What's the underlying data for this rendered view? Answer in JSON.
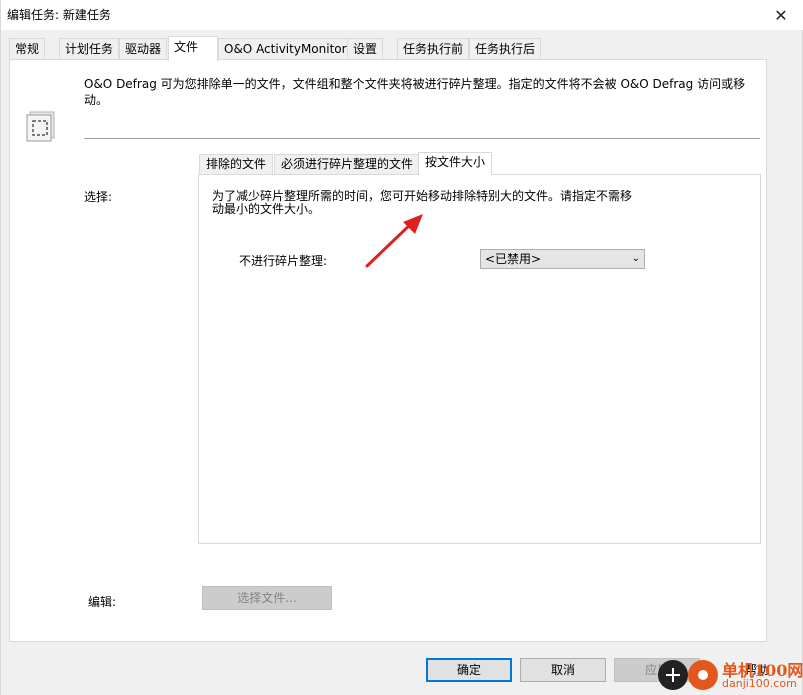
{
  "window": {
    "title": "编辑任务: 新建任务"
  },
  "tabs": [
    {
      "label": "常规"
    },
    {
      "label": "计划任务"
    },
    {
      "label": "驱动器"
    },
    {
      "label": "文件"
    },
    {
      "label": "O&O ActivityMonitor"
    },
    {
      "label": "设置"
    },
    {
      "label": "任务执行前"
    },
    {
      "label": "任务执行后"
    }
  ],
  "active_tab": "文件",
  "files": {
    "description": "O&O Defrag 可为您排除单一的文件，文件组和整个文件夹将被进行碎片整理。指定的文件将不会被 O&O Defrag 访问或移动。",
    "select_label": "选择:",
    "edit_label": "编辑:",
    "choose_files_button": "选择文件..."
  },
  "subtabs": [
    {
      "label": "排除的文件"
    },
    {
      "label": "必须进行碎片整理的文件"
    },
    {
      "label": "按文件大小"
    }
  ],
  "by_size": {
    "info": "为了减少碎片整理所需的时间，您可开始移动排除特别大的文件。请指定不需移动最小的文件大小。",
    "no_defrag_label": "不进行碎片整理:",
    "no_defrag_value": "<已禁用>"
  },
  "buttons": {
    "ok": "确定",
    "cancel": "取消",
    "apply": "应用",
    "help": "帮助"
  },
  "watermark": {
    "main": "单机100网",
    "sub": "danji100.com"
  },
  "colors": {
    "accent": "#0078d7",
    "arrow": "#e02020",
    "watermark": "#e4571c"
  }
}
